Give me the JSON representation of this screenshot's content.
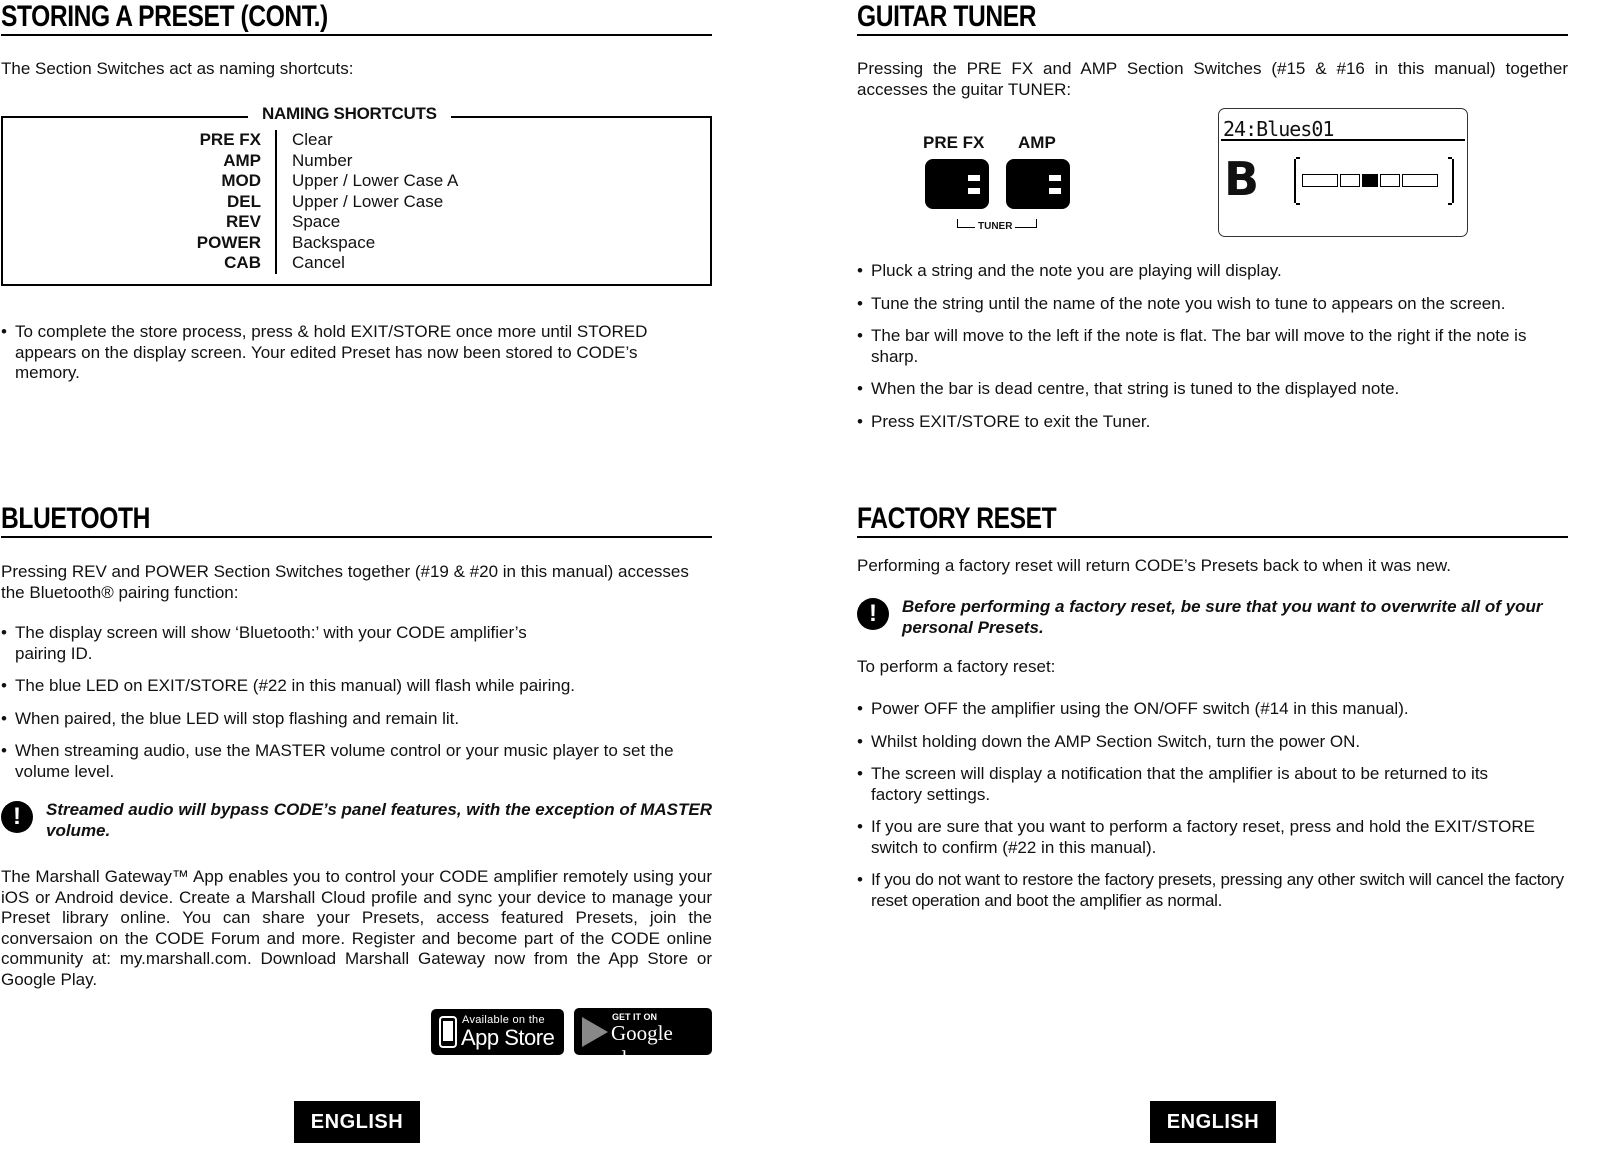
{
  "left_page": {
    "storing": {
      "title": "STORING A PRESET (CONT.)",
      "intro": "The Section Switches act as naming shortcuts:",
      "shortcuts_title": "NAMING SHORTCUTS",
      "shortcuts": [
        {
          "key": "PRE FX",
          "value": "Clear"
        },
        {
          "key": "AMP",
          "value": "Number"
        },
        {
          "key": "MOD",
          "value": "Upper / Lower Case A"
        },
        {
          "key": "DEL",
          "value": "Upper / Lower Case"
        },
        {
          "key": "REV",
          "value": "Space"
        },
        {
          "key": "POWER",
          "value": "Backspace"
        },
        {
          "key": "CAB",
          "value": "Cancel"
        }
      ],
      "bullets": [
        "To complete the store process, press & hold EXIT/STORE once more until STORED appears on the display screen. Your edited Preset has now been stored to CODE’s memory."
      ]
    },
    "bluetooth": {
      "title": "BLUETOOTH",
      "intro": "Pressing REV and POWER Section Switches together (#19 & #20 in this manual) accesses the Bluetooth® pairing function:",
      "bullets": [
        "The display screen will show ‘Bluetooth:’ with your CODE amplifier’s pairing ID.",
        "The blue LED on EXIT/STORE (#22 in this manual) will flash while pairing.",
        "When paired, the blue LED will stop flashing and remain lit.",
        "When streaming audio, use the MASTER volume control or your music player to set the volume level."
      ],
      "warning": "Streamed audio will bypass CODE’s panel features, with the exception of MASTER volume.",
      "gateway_text": "The Marshall Gateway™ App enables you to control your CODE amplifier remotely using your iOS or Android device. Create a Marshall Cloud profile and sync your device to manage your Preset library online. You can share your Presets, access featured Presets, join the conversaion on the CODE Forum and more. Register and become part of the CODE online community at: my.marshall.com. Download Marshall Gateway now from the App Store or Google Play.",
      "app_store": {
        "small": "Available on the",
        "big": "App Store"
      },
      "google_play": {
        "small": "GET IT ON",
        "big": "Google play"
      }
    },
    "language_tab": "ENGLISH"
  },
  "right_page": {
    "tuner": {
      "title": "GUITAR TUNER",
      "intro": "Pressing the PRE FX and AMP Section Switches (#15 & #16 in this manual) together accesses the guitar TUNER:",
      "switch_labels": [
        "PRE FX",
        "AMP"
      ],
      "bracket_label": "TUNER",
      "lcd_preset": "24:Blues01",
      "lcd_note": "B",
      "meter_active_segment": 3,
      "meter_segments": 5,
      "bullets": [
        "Pluck a string and the note you are playing will display.",
        "Tune the string until the name of the note you wish to tune to appears on the screen.",
        "The bar will move to the left if the note is flat. The bar will move to the right if the note is sharp.",
        "When the bar is dead centre, that string is tuned to the displayed note.",
        "Press EXIT/STORE to exit the Tuner."
      ]
    },
    "reset": {
      "title": "FACTORY RESET",
      "intro": "Performing a factory reset will return CODE’s Presets back to when it was new.",
      "warning": "Before performing a factory reset, be sure that you want to overwrite all of your personal Presets.",
      "subintro": "To perform a factory reset:",
      "bullets": [
        "Power OFF the amplifier using the ON/OFF switch (#14 in this manual).",
        "Whilst holding down the AMP Section Switch, turn the power ON.",
        "The screen will display a notification that the amplifier is about to be returned to its factory settings.",
        "If you are sure that you want to perform a factory reset, press and hold the EXIT/STORE switch to confirm (#22 in this manual).",
        "If you do not want to restore the factory presets, pressing any other switch will cancel the factory reset operation and boot the amplifier as normal."
      ]
    },
    "language_tab": "ENGLISH"
  }
}
